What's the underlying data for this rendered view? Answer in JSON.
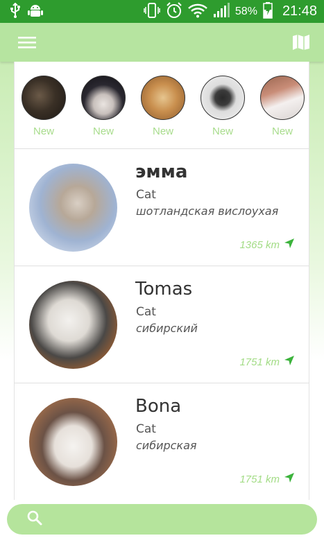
{
  "status_bar": {
    "battery_percent": "58%",
    "time": "21:48"
  },
  "toolbar": {
    "menu_icon": "hamburger-menu-icon",
    "map_icon": "map-icon"
  },
  "stories": [
    {
      "label": "New",
      "colors": [
        "#3a3026",
        "#7a6a55"
      ]
    },
    {
      "label": "New",
      "colors": [
        "#26242a",
        "#d8d2cf"
      ]
    },
    {
      "label": "New",
      "colors": [
        "#b77a3d",
        "#e3c08a"
      ]
    },
    {
      "label": "New",
      "colors": [
        "#e8e6e6",
        "#1e1e1e"
      ]
    },
    {
      "label": "New",
      "colors": [
        "#8a5a4a",
        "#f0eeee"
      ]
    }
  ],
  "pets": [
    {
      "name": "эмма",
      "type": "Cat",
      "breed": "шотландская вислоухая",
      "distance": "1365 km"
    },
    {
      "name": "Tomas",
      "type": "Cat",
      "breed": "сибирский",
      "distance": "1751 km"
    },
    {
      "name": "Bona",
      "type": "Cat",
      "breed": "сибирская",
      "distance": "1751 km"
    }
  ],
  "search": {
    "placeholder": ""
  },
  "colors": {
    "status_bar": "#2e9c2e",
    "toolbar": "#b6e4a0",
    "accent_light": "#a8dc8c",
    "distance_arrow": "#3cb33c"
  }
}
